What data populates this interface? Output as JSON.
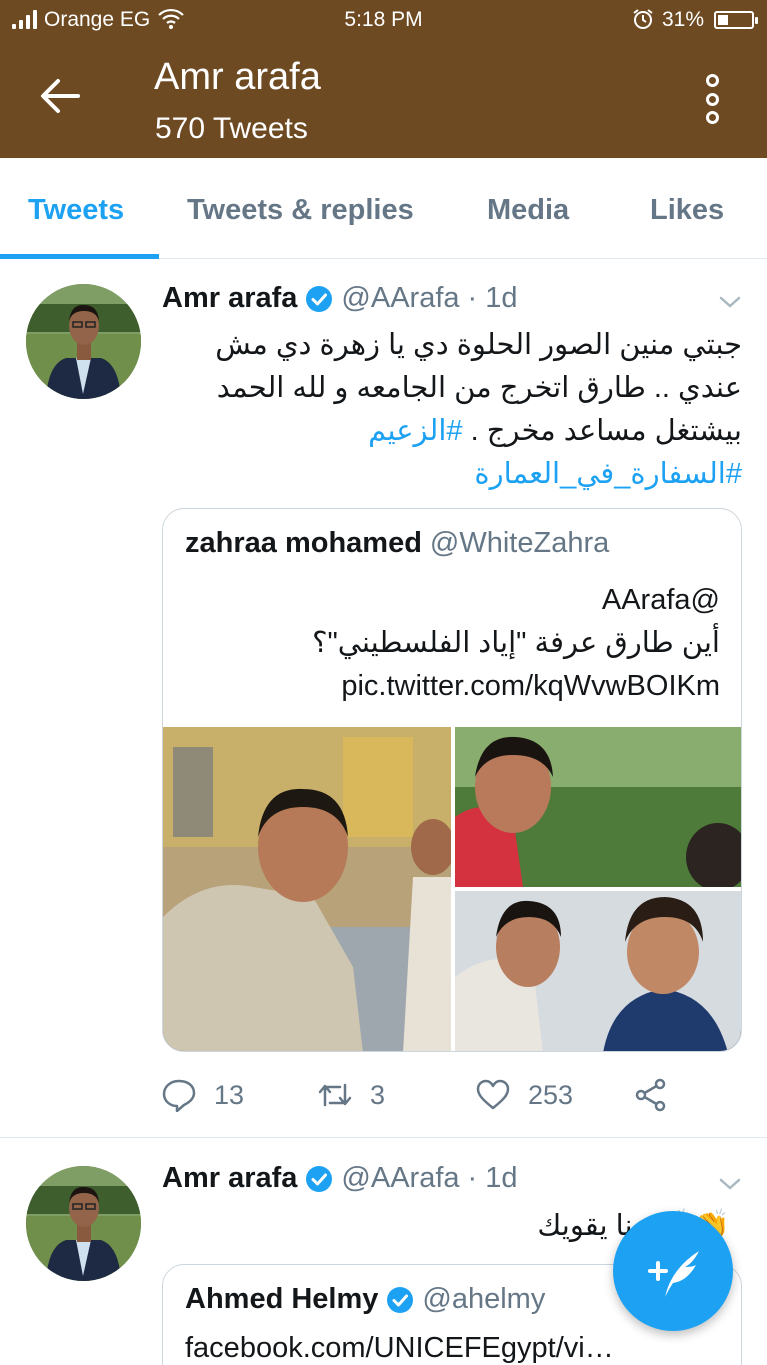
{
  "status_bar": {
    "carrier": "Orange EG",
    "time": "5:18 PM",
    "battery": "31%",
    "battery_level": 0.31
  },
  "header": {
    "title": "Amr arafa",
    "subtitle": "570 Tweets",
    "back_icon": "arrow-left-icon",
    "menu_icon": "more-vertical-icon"
  },
  "tabs": [
    {
      "label": "Tweets",
      "active": true
    },
    {
      "label": "Tweets & replies",
      "active": false
    },
    {
      "label": "Media",
      "active": false
    },
    {
      "label": "Likes",
      "active": false
    }
  ],
  "tweets": [
    {
      "name": "Amr arafa",
      "handle_time": "@AArafa · 1d",
      "text_plain": "جبتي منين الصور الحلوة دي يا زهرة دي مش عندي .. طارق اتخرج من الجامعه و لله الحمد بيشتغل مساعد مخرج .",
      "hashtag1": "#الزعيم",
      "hashtag2": "#السفارة_في_العمارة",
      "quote": {
        "name": "zahraa mohamed",
        "handle": "@WhiteZahra",
        "line1": "@AArafa",
        "line2": "أين طارق عرفة \"إياد الفلسطيني\"؟",
        "line3": "pic.twitter.com/kqWvwBOIKm"
      },
      "replies": "13",
      "retweets": "3",
      "likes": "253"
    },
    {
      "name": "Amr arafa",
      "handle_time": "@AArafa · 1d",
      "text": "ربنا يقويك",
      "quote": {
        "name": "Ahmed Helmy",
        "handle": "@ahelmy",
        "line1": "facebook.com/UNICEFEgypt/vi…"
      }
    }
  ],
  "fab": {
    "icon": "compose-tweet-icon"
  },
  "colors": {
    "header_bg": "#6d4a22",
    "accent": "#1da1f2",
    "secondary_text": "#657786",
    "border": "#e1e8ed"
  }
}
